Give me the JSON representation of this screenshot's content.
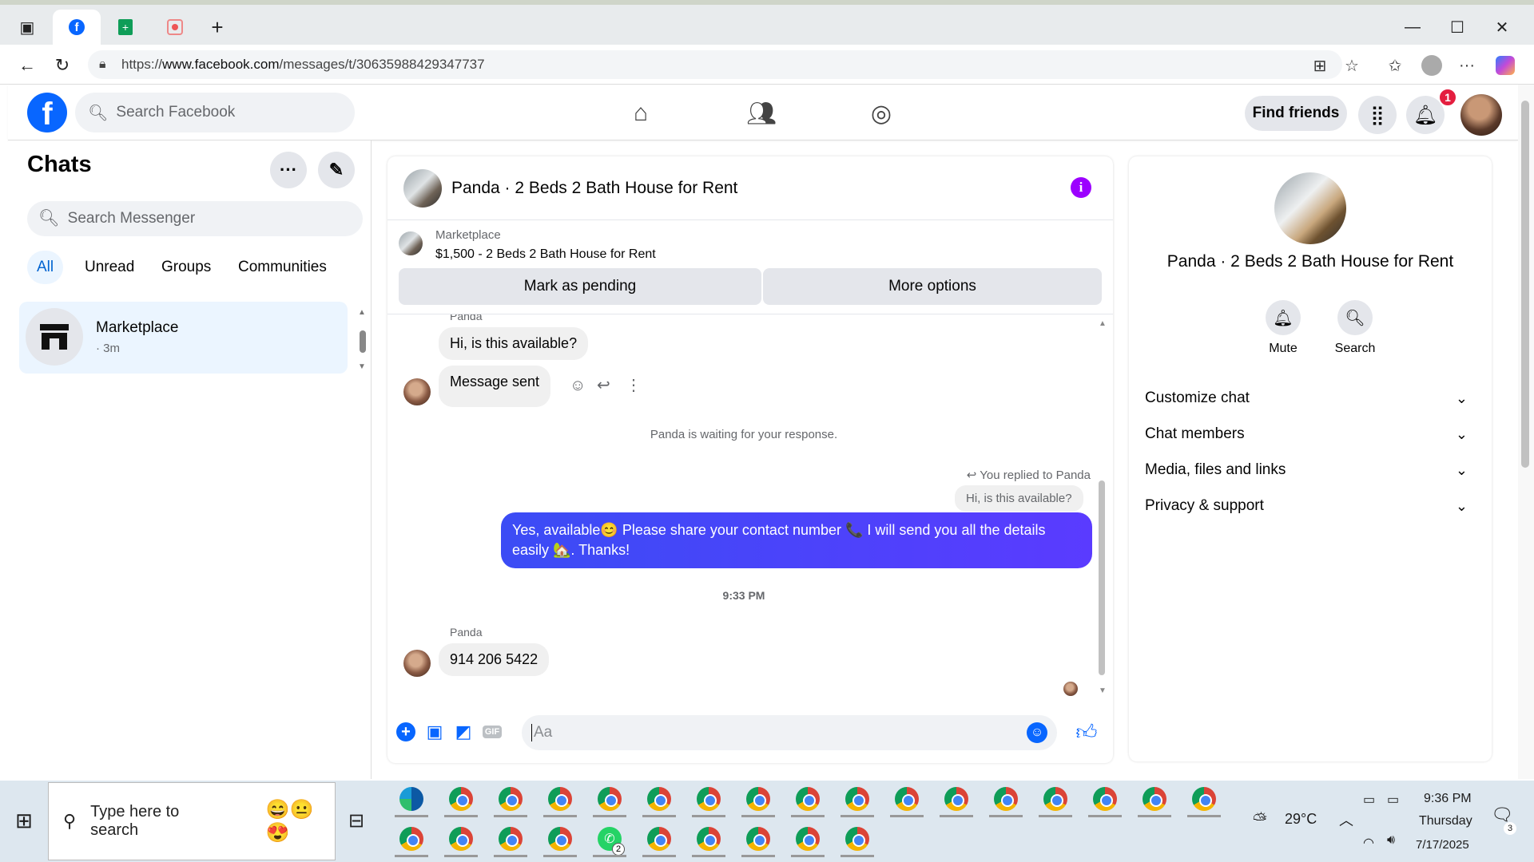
{
  "browser": {
    "url_prefix": "https://",
    "url_host": "www.facebook.com",
    "url_path": "/messages/t/30635988429347737"
  },
  "fb_header": {
    "logo": "f",
    "search_placeholder": "Search Facebook",
    "find_friends": "Find friends",
    "notification_count": "1"
  },
  "left": {
    "title": "Chats",
    "search_placeholder": "Search Messenger",
    "filters": [
      "All",
      "Unread",
      "Groups",
      "Communities"
    ],
    "chats": [
      {
        "name": "Marketplace",
        "time": "· 3m"
      }
    ]
  },
  "conversation": {
    "title": "Panda · 2 Beds 2 Bath House for Rent",
    "marketplace_label": "Marketplace",
    "listing": "$1,500 - 2 Beds 2 Bath House for Rent",
    "mark_pending": "Mark as pending",
    "more_options": "More options",
    "sender_top": "Panda",
    "msg1": "Hi, is this available?",
    "msg2": "Message sent",
    "waiting": "Panda is waiting for your response.",
    "replied_to": "You replied to Panda",
    "reply_quote": "Hi, is this available?",
    "out_msg_line1": "Yes, available😊 Please share your contact number 📞 I will send you all the details",
    "out_msg_line2": "easily 🏡. Thanks!",
    "timestamp": "9:33 PM",
    "sender2": "Panda",
    "msg3": "914 206 5422",
    "composer_placeholder": "Aa"
  },
  "right": {
    "title": "Panda · 2 Beds 2 Bath House for Rent",
    "mute": "Mute",
    "search": "Search",
    "sections": [
      "Customize chat",
      "Chat members",
      "Media, files and links",
      "Privacy & support"
    ]
  },
  "taskbar": {
    "search_placeholder": "Type here to search",
    "weather": "29°C",
    "time": "9:36 PM",
    "day": "Thursday",
    "date": "7/17/2025",
    "whatsapp_badge": "2",
    "notif_count": "3"
  }
}
